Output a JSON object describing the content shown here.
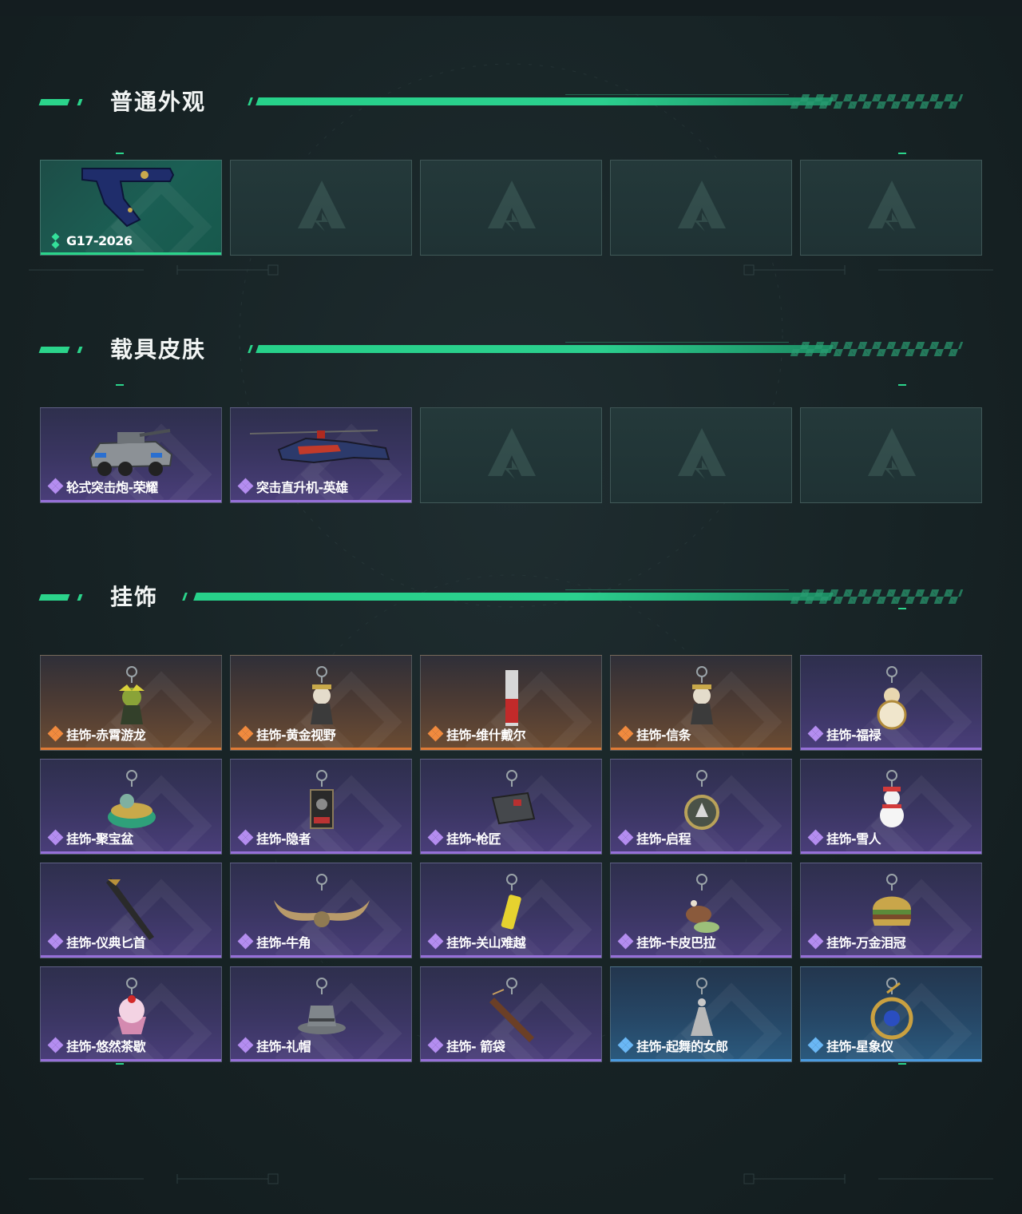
{
  "sections": [
    {
      "title": "普通外观",
      "items": [
        {
          "name": "G17-2026",
          "rarity": "green",
          "icon": "pistol-icon"
        },
        {
          "name": "",
          "rarity": "empty"
        },
        {
          "name": "",
          "rarity": "empty"
        },
        {
          "name": "",
          "rarity": "empty"
        },
        {
          "name": "",
          "rarity": "empty"
        }
      ]
    },
    {
      "title": "载具皮肤",
      "items": [
        {
          "name": "轮式突击炮-荣耀",
          "rarity": "purple",
          "icon": "armored-vehicle-icon"
        },
        {
          "name": "突击直升机-英雄",
          "rarity": "purple",
          "icon": "helicopter-icon"
        },
        {
          "name": "",
          "rarity": "empty"
        },
        {
          "name": "",
          "rarity": "empty"
        },
        {
          "name": "",
          "rarity": "empty"
        }
      ]
    },
    {
      "title": "挂饰",
      "items": [
        {
          "name": "挂饰-赤霄游龙",
          "rarity": "orange",
          "icon": "dragon-charm-icon"
        },
        {
          "name": "挂饰-黄金视野",
          "rarity": "orange",
          "icon": "figure-charm-icon"
        },
        {
          "name": "挂饰-维什戴尔",
          "rarity": "orange",
          "icon": "tag-charm-icon"
        },
        {
          "name": "挂饰-信条",
          "rarity": "orange",
          "icon": "figure-charm-icon"
        },
        {
          "name": "挂饰-福禄",
          "rarity": "purple",
          "icon": "gourd-charm-icon"
        },
        {
          "name": "挂饰-聚宝盆",
          "rarity": "purple",
          "icon": "treasure-bowl-charm-icon"
        },
        {
          "name": "挂饰-隐者",
          "rarity": "purple",
          "icon": "card-charm-icon"
        },
        {
          "name": "挂饰-枪匠",
          "rarity": "purple",
          "icon": "box-charm-icon"
        },
        {
          "name": "挂饰-启程",
          "rarity": "purple",
          "icon": "medal-charm-icon"
        },
        {
          "name": "挂饰-雪人",
          "rarity": "purple",
          "icon": "snowman-charm-icon"
        },
        {
          "name": "挂饰-仪典匕首",
          "rarity": "purple",
          "icon": "dagger-charm-icon"
        },
        {
          "name": "挂饰-牛角",
          "rarity": "purple",
          "icon": "horns-charm-icon"
        },
        {
          "name": "挂饰-关山难越",
          "rarity": "purple",
          "icon": "canister-charm-icon"
        },
        {
          "name": "挂饰-卡皮巴拉",
          "rarity": "purple",
          "icon": "capybara-charm-icon"
        },
        {
          "name": "挂饰-万金泪冠",
          "rarity": "purple",
          "icon": "burger-charm-icon"
        },
        {
          "name": "挂饰-悠然茶歇",
          "rarity": "purple",
          "icon": "cupcake-charm-icon"
        },
        {
          "name": "挂饰-礼帽",
          "rarity": "purple",
          "icon": "hat-charm-icon"
        },
        {
          "name": "挂饰- 箭袋",
          "rarity": "purple",
          "icon": "quiver-charm-icon"
        },
        {
          "name": "挂饰-起舞的女郎",
          "rarity": "blue",
          "icon": "dancer-charm-icon"
        },
        {
          "name": "挂饰-星象仪",
          "rarity": "blue",
          "icon": "astrolabe-charm-icon"
        }
      ]
    }
  ],
  "colors": {
    "accent_green": "#2bd48b",
    "rarity_purple": "#9670d8",
    "rarity_orange": "#e07b35",
    "rarity_blue": "#4a9be0"
  }
}
